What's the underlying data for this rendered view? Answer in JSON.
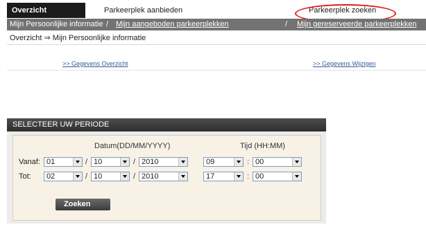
{
  "topnav": {
    "overzicht": "Overzicht",
    "aanbieden": "Parkeerplek aanbieden",
    "zoeken": "Parkeerplek zoeken"
  },
  "subnav": {
    "item1": "Mijn Persoonlijke informatie",
    "sep1": "/",
    "item2": "Mijn aangeboden parkeerplekken",
    "sep2": "/",
    "item3": "Mijn gereserveerde parkeerplekken"
  },
  "breadcrumb": "Overzicht ⇒ Mijn Persoonlijke informatie",
  "links": {
    "gegevens_overzicht": ">> Gegevens Overzicht",
    "gegevens_wijzigen": ">> Gegevens Wijzigen"
  },
  "period": {
    "title": "SELECTEER UW PERIODE",
    "datum_header": "Datum(DD/MM/YYYY)",
    "tijd_header": "Tijd (HH:MM)",
    "vanaf_label": "Vanaf:",
    "tot_label": "Tot:",
    "vanaf": {
      "day": "01",
      "month": "10",
      "year": "2010",
      "hour": "09",
      "minute": "00"
    },
    "tot": {
      "day": "02",
      "month": "10",
      "year": "2010",
      "hour": "17",
      "minute": "00"
    },
    "slash": "/",
    "colon": ":",
    "search_button": "Zoeken"
  },
  "colors": {
    "highlight": "#e11b1b",
    "nav_active": "#1b1b1b",
    "subnav_bg": "#737373",
    "link": "#355a9a"
  }
}
